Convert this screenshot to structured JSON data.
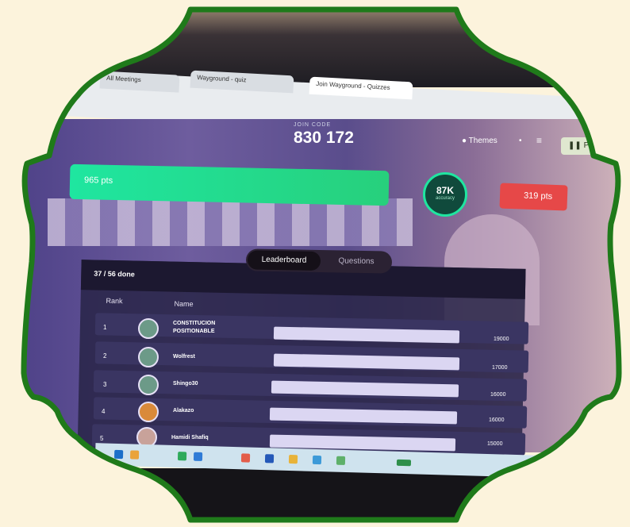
{
  "browser": {
    "tabs": [
      {
        "label": "All Meetings"
      },
      {
        "label": "Wayground - quiz"
      },
      {
        "label": "Join Wayground - Quizzes"
      }
    ]
  },
  "header": {
    "join_code_label": "JOIN CODE",
    "join_code": "830 172",
    "theme_label": "Themes",
    "pause_label": "Pause"
  },
  "progress": {
    "team_points": "965 pts",
    "score_value": "87K",
    "score_caption": "accuracy",
    "opponent_points": "319 pts",
    "team_fill": 1.0
  },
  "tabs": {
    "leaderboard": "Leaderboard",
    "questions": "Questions"
  },
  "leaderboard": {
    "joined": "37 / 56 done",
    "col_rank": "Rank",
    "col_name": "Name",
    "rows": [
      {
        "rank": "1",
        "name_line1": "CONSTITUCION",
        "name_line2": "POSITIONABLE",
        "points": "19000"
      },
      {
        "rank": "2",
        "name_line1": "Wolfrest",
        "name_line2": "",
        "points": "17000"
      },
      {
        "rank": "3",
        "name_line1": "Shingo30",
        "name_line2": "",
        "points": "16000"
      },
      {
        "rank": "4",
        "name_line1": "Alakazo",
        "name_line2": "",
        "points": "16000"
      },
      {
        "rank": "5",
        "name_line1": "Hamidi Shafiq",
        "name_line2": "",
        "points": "15000"
      }
    ]
  },
  "colors": {
    "frame": "#1f7a1a",
    "accent_green": "#1fe6a0",
    "accent_red": "#e64848",
    "background": "#fcf3dc"
  }
}
